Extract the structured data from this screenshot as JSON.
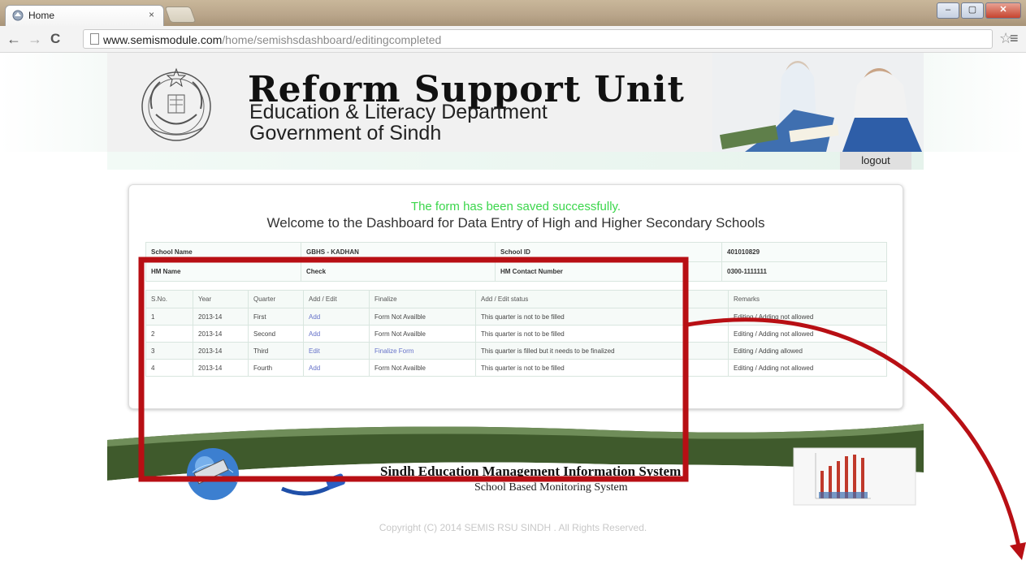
{
  "browser": {
    "tab_title": "Home",
    "tab_close": "×",
    "url_domain": "www.semismodule.com",
    "url_path": "/home/semishsdashboard/editingcompleted",
    "back_icon": "back-arrow-icon",
    "forward_icon": "forward-arrow-icon",
    "reload_icon": "reload-icon"
  },
  "header": {
    "title": "Reform Support Unit",
    "subtitle1": "Education & Literacy Department",
    "subtitle2": "Government of Sindh",
    "logout": "logout"
  },
  "dashboard": {
    "success_message": "The form has been saved successfully.",
    "welcome": "Welcome to the Dashboard for Data Entry of High and Higher Secondary Schools",
    "info": {
      "school_name_label": "School Name",
      "school_name_value": "GBHS - KADHAN",
      "school_id_label": "School ID",
      "school_id_value": "401010829",
      "hm_name_label": "HM Name",
      "hm_name_value": "Check",
      "hm_contact_label": "HM Contact Number",
      "hm_contact_value": "0300-1111111"
    },
    "columns": [
      "S.No.",
      "Year",
      "Quarter",
      "Add / Edit",
      "Finalize",
      "Add / Edit status",
      "Remarks"
    ],
    "rows": [
      {
        "sno": "1",
        "year": "2013-14",
        "quarter": "First",
        "action": "Add",
        "finalize": "Form Not Availble",
        "status": "This quarter is not to be filled",
        "remarks": "Editing / Adding not allowed"
      },
      {
        "sno": "2",
        "year": "2013-14",
        "quarter": "Second",
        "action": "Add",
        "finalize": "Form Not Availble",
        "status": "This quarter is not to be filled",
        "remarks": "Editing / Adding not allowed"
      },
      {
        "sno": "3",
        "year": "2013-14",
        "quarter": "Third",
        "action": "Edit",
        "finalize": "Finalize Form",
        "status": "This quarter is filled but it needs to be finalized",
        "remarks": "Editing / Adding allowed"
      },
      {
        "sno": "4",
        "year": "2013-14",
        "quarter": "Fourth",
        "action": "Add",
        "finalize": "Form Not Availble",
        "status": "This quarter is not to be filled",
        "remarks": "Editing / Adding not allowed"
      }
    ]
  },
  "footer": {
    "system_title": "Sindh  Education Management Information System",
    "system_subtitle": "School Based Monitoring System",
    "copyright": "Copyright (C) 2014 SEMIS RSU SINDH . All Rights Reserved."
  },
  "annotation": {
    "color": "#b80f14"
  }
}
